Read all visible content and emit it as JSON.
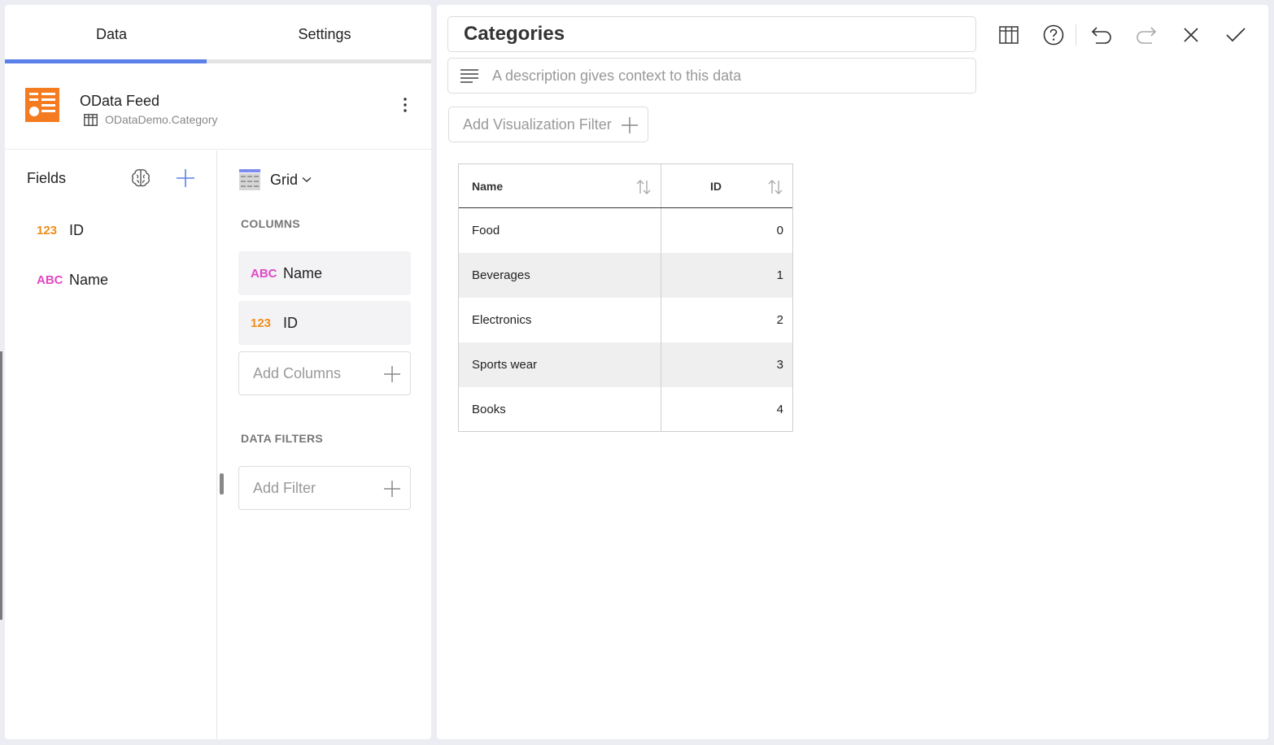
{
  "tabs": [
    {
      "label": "Data",
      "active": true
    },
    {
      "label": "Settings",
      "active": false
    }
  ],
  "source": {
    "title": "OData Feed",
    "subtitle": "ODataDemo.Category",
    "logo_color": "#f47b20"
  },
  "fields": {
    "title": "Fields",
    "items": [
      {
        "type": "123",
        "name": "ID"
      },
      {
        "type": "ABC",
        "name": "Name"
      }
    ]
  },
  "config": {
    "viz_type": "Grid",
    "columns_label": "COLUMNS",
    "columns": [
      {
        "type": "ABC",
        "name": "Name"
      },
      {
        "type": "123",
        "name": "ID"
      }
    ],
    "add_columns_label": "Add Columns",
    "data_filters_label": "DATA FILTERS",
    "add_filter_label": "Add Filter"
  },
  "editor": {
    "title": "Categories",
    "description_placeholder": "A description gives context to this data",
    "add_viz_filter_label": "Add Visualization Filter"
  },
  "grid": {
    "headers": [
      "Name",
      "ID"
    ],
    "rows": [
      {
        "name": "Food",
        "id": "0"
      },
      {
        "name": "Beverages",
        "id": "1"
      },
      {
        "name": "Electronics",
        "id": "2"
      },
      {
        "name": "Sports wear",
        "id": "3"
      },
      {
        "name": "Books",
        "id": "4"
      }
    ]
  },
  "colors": {
    "accent": "#5b80e8",
    "number_type": "#f08c1a",
    "text_type": "#e048c6"
  }
}
